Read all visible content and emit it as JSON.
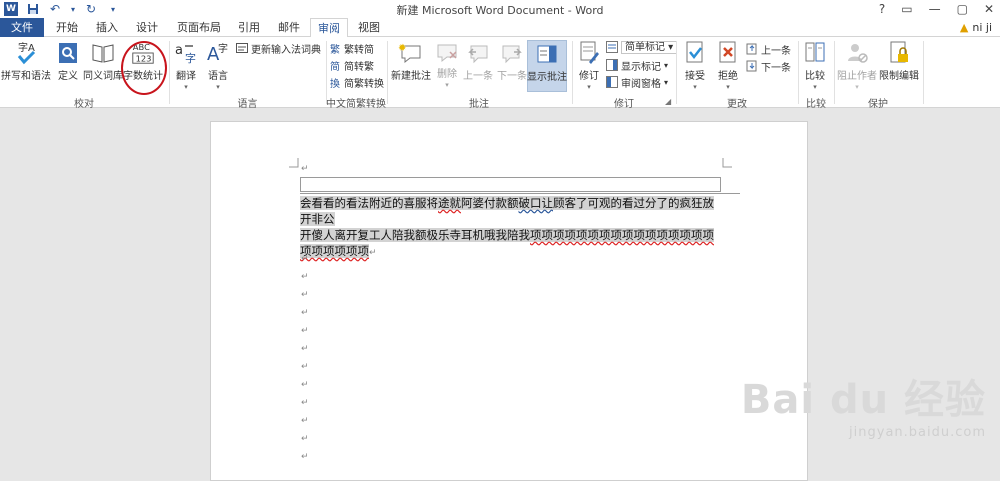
{
  "window": {
    "title": "新建 Microsoft Word Document - Word",
    "controls": [
      "?",
      "▭",
      "—",
      "▢",
      "✕"
    ]
  },
  "tabs": [
    "文件",
    "开始",
    "插入",
    "设计",
    "页面布局",
    "引用",
    "邮件",
    "审阅",
    "视图"
  ],
  "user": {
    "name": "ni ji"
  },
  "ribbon": {
    "groups": {
      "proofing": {
        "label": "校对",
        "spelling": "拼写和语法",
        "define": "定义",
        "thesaurus": "同义词库",
        "wordcount": "字数统计"
      },
      "language": {
        "label": "语言",
        "translate": "翻译",
        "language": "语言",
        "update_ime": "更新输入法词典"
      },
      "chinese": {
        "label": "中文简繁转换",
        "to_simplified": "繁转简",
        "to_traditional": "简转繁",
        "convert": "简繁转换"
      },
      "comments": {
        "label": "批注",
        "new": "新建批注",
        "delete": "删除",
        "prev": "上一条",
        "next": "下一条",
        "show": "显示批注"
      },
      "tracking": {
        "label": "修订",
        "track": "修订",
        "markup_mode": "简单标记",
        "show_markup": "显示标记",
        "review_pane": "审阅窗格"
      },
      "changes": {
        "label": "更改",
        "accept": "接受",
        "reject": "拒绝",
        "prev": "上一条",
        "next": "下一条"
      },
      "compare": {
        "label": "比较",
        "compare": "比较"
      },
      "protect": {
        "label": "保护",
        "block_authors": "阻止作者",
        "restrict": "限制编辑"
      }
    }
  },
  "document": {
    "line1": "会看看的看法附近的喜服将",
    "line1_sq1": "途就",
    "line1_b": "阿婆付款额",
    "line1_sq2": "破口让",
    "line1_c": "顾客了可观的看过分了的疯狂放开非公",
    "line2a": "开傻人离开复工人陪我额极乐寺耳机哦我陪我",
    "line2_sq": "项项项项项项项项项项项项项项项项",
    "line3_sq": "项项项项项项",
    "para_mark": "↵"
  },
  "watermark": {
    "main": "Bai du 经验",
    "sub": "jingyan.baidu.com"
  }
}
